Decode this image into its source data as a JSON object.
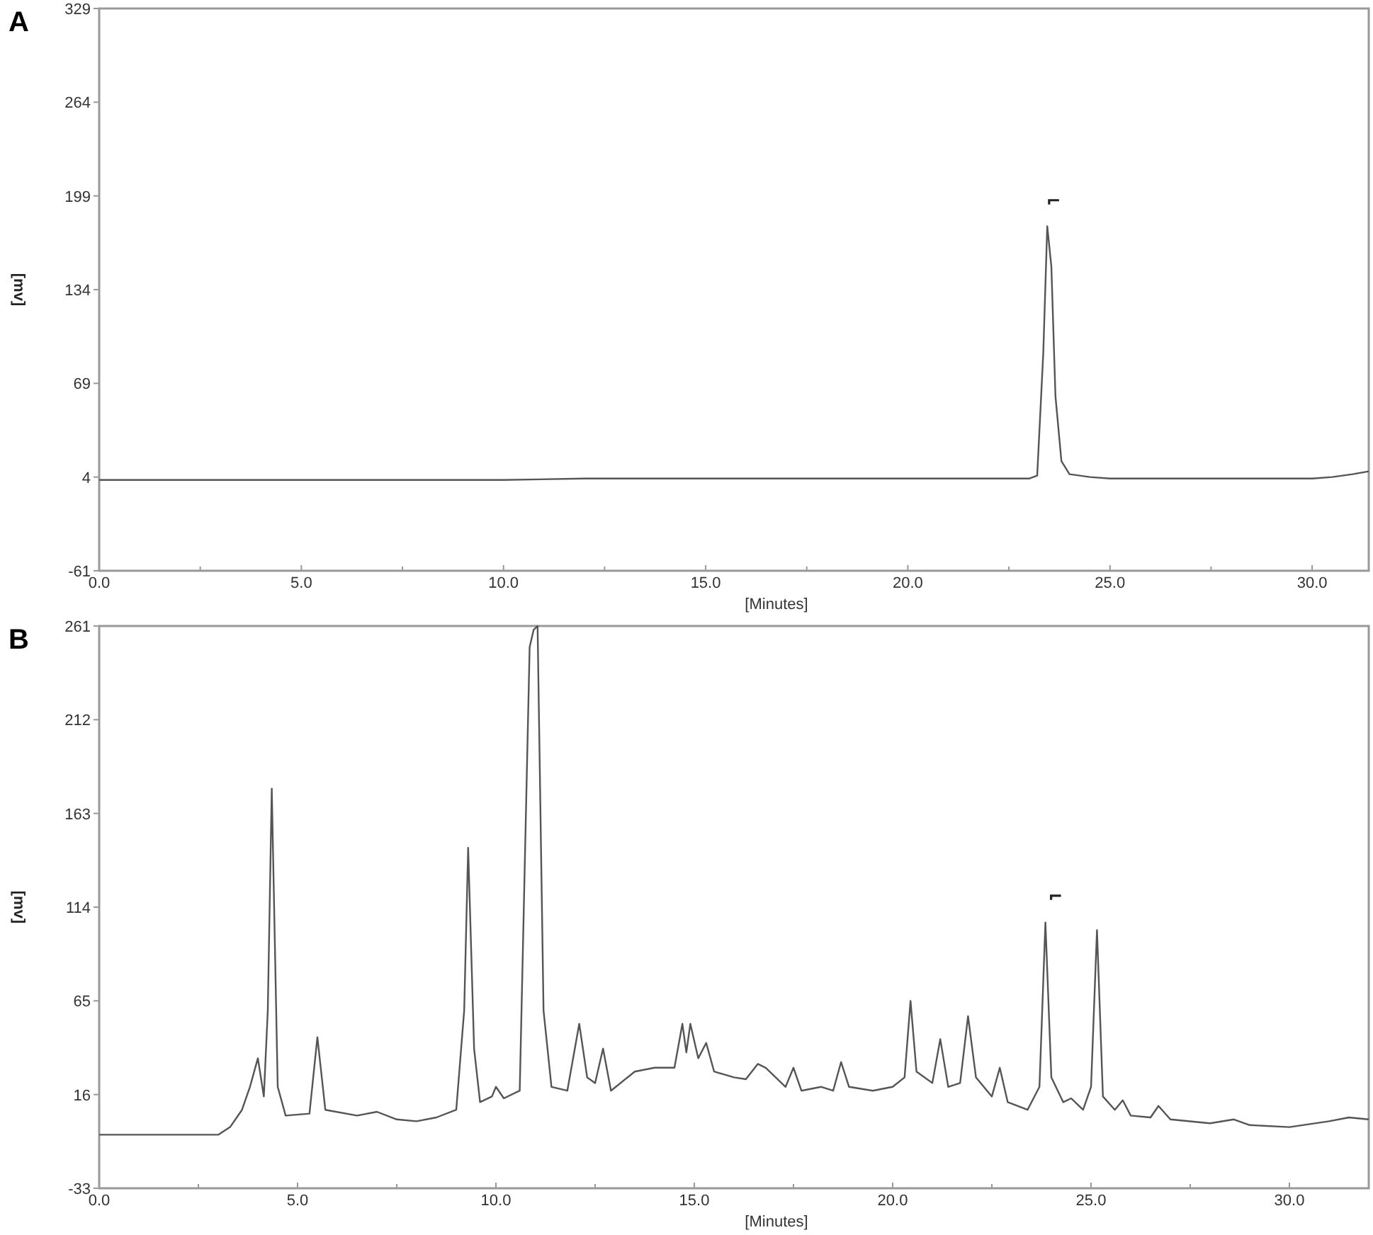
{
  "panels": [
    {
      "label": "A",
      "chart_data": {
        "type": "line",
        "xlabel": "[Minutes]",
        "ylabel": "[mv]",
        "xlim": [
          0,
          31.4
        ],
        "ylim": [
          -61,
          329
        ],
        "xticks": [
          {
            "value": 0,
            "label": "0.0"
          },
          {
            "value": 5,
            "label": "5.0"
          },
          {
            "value": 10,
            "label": "10.0"
          },
          {
            "value": 15,
            "label": "15.0"
          },
          {
            "value": 20,
            "label": "20.0"
          },
          {
            "value": 25,
            "label": "25.0"
          },
          {
            "value": 30,
            "label": "30.0"
          }
        ],
        "yticks": [
          -61,
          4,
          69,
          134,
          199,
          264,
          329
        ],
        "x": [
          0,
          1,
          2,
          3,
          4,
          5,
          6,
          7,
          8,
          9,
          10,
          12,
          14,
          16,
          18,
          20,
          22,
          23,
          23.2,
          23.35,
          23.45,
          23.55,
          23.65,
          23.8,
          24,
          24.5,
          25,
          26,
          27,
          28,
          29,
          30,
          30.5,
          31,
          31.4
        ],
        "values": [
          2,
          2,
          2,
          2,
          2,
          2,
          2,
          2,
          2,
          2,
          2,
          3,
          3,
          3,
          3,
          3,
          3,
          3,
          5,
          90,
          178,
          150,
          60,
          15,
          6,
          4,
          3,
          3,
          3,
          3,
          3,
          3,
          4,
          6,
          8
        ]
      }
    },
    {
      "label": "B",
      "chart_data": {
        "type": "line",
        "xlabel": "[Minutes]",
        "ylabel": "[mv]",
        "xlim": [
          0,
          32
        ],
        "ylim": [
          -33,
          261
        ],
        "xticks": [
          {
            "value": 0,
            "label": "0.0"
          },
          {
            "value": 5,
            "label": "5.0"
          },
          {
            "value": 10,
            "label": "10.0"
          },
          {
            "value": 15,
            "label": "15.0"
          },
          {
            "value": 20,
            "label": "20.0"
          },
          {
            "value": 25,
            "label": "25.0"
          },
          {
            "value": 30,
            "label": "30.0"
          }
        ],
        "yticks": [
          -33,
          16,
          65,
          114,
          163,
          212,
          261
        ],
        "x": [
          0,
          3,
          3.3,
          3.6,
          3.8,
          4,
          4.15,
          4.25,
          4.35,
          4.5,
          4.7,
          5.3,
          5.5,
          5.7,
          6.5,
          7,
          7.5,
          8,
          8.5,
          9,
          9.2,
          9.3,
          9.45,
          9.6,
          9.9,
          10,
          10.2,
          10.6,
          10.85,
          10.95,
          11.05,
          11.2,
          11.4,
          11.8,
          12.1,
          12.3,
          12.5,
          12.7,
          12.9,
          13.5,
          14,
          14.5,
          14.7,
          14.8,
          14.9,
          15.1,
          15.3,
          15.5,
          16,
          16.3,
          16.6,
          16.8,
          17,
          17.3,
          17.5,
          17.7,
          18.2,
          18.5,
          18.7,
          18.9,
          19.5,
          20,
          20.3,
          20.45,
          20.6,
          21,
          21.2,
          21.4,
          21.7,
          21.9,
          22.1,
          22.5,
          22.7,
          22.9,
          23.4,
          23.7,
          23.85,
          24,
          24.3,
          24.5,
          24.8,
          25,
          25.15,
          25.3,
          25.6,
          25.8,
          26,
          26.5,
          26.7,
          27,
          28,
          28.6,
          29,
          30,
          31,
          31.5,
          32
        ],
        "values": [
          -5,
          -5,
          -1,
          8,
          20,
          35,
          15,
          60,
          176,
          20,
          5,
          6,
          46,
          8,
          5,
          7,
          3,
          2,
          4,
          8,
          60,
          145,
          40,
          12,
          15,
          20,
          14,
          18,
          250,
          259,
          261,
          60,
          20,
          18,
          53,
          25,
          22,
          40,
          18,
          28,
          30,
          30,
          53,
          38,
          53,
          35,
          43,
          28,
          25,
          24,
          32,
          30,
          26,
          20,
          30,
          18,
          20,
          18,
          33,
          20,
          18,
          20,
          25,
          65,
          28,
          22,
          45,
          20,
          22,
          57,
          25,
          15,
          30,
          12,
          8,
          20,
          106,
          25,
          12,
          14,
          8,
          20,
          102,
          15,
          8,
          13,
          5,
          4,
          10,
          3,
          1,
          3,
          0,
          -1,
          2,
          4,
          3
        ]
      }
    }
  ]
}
